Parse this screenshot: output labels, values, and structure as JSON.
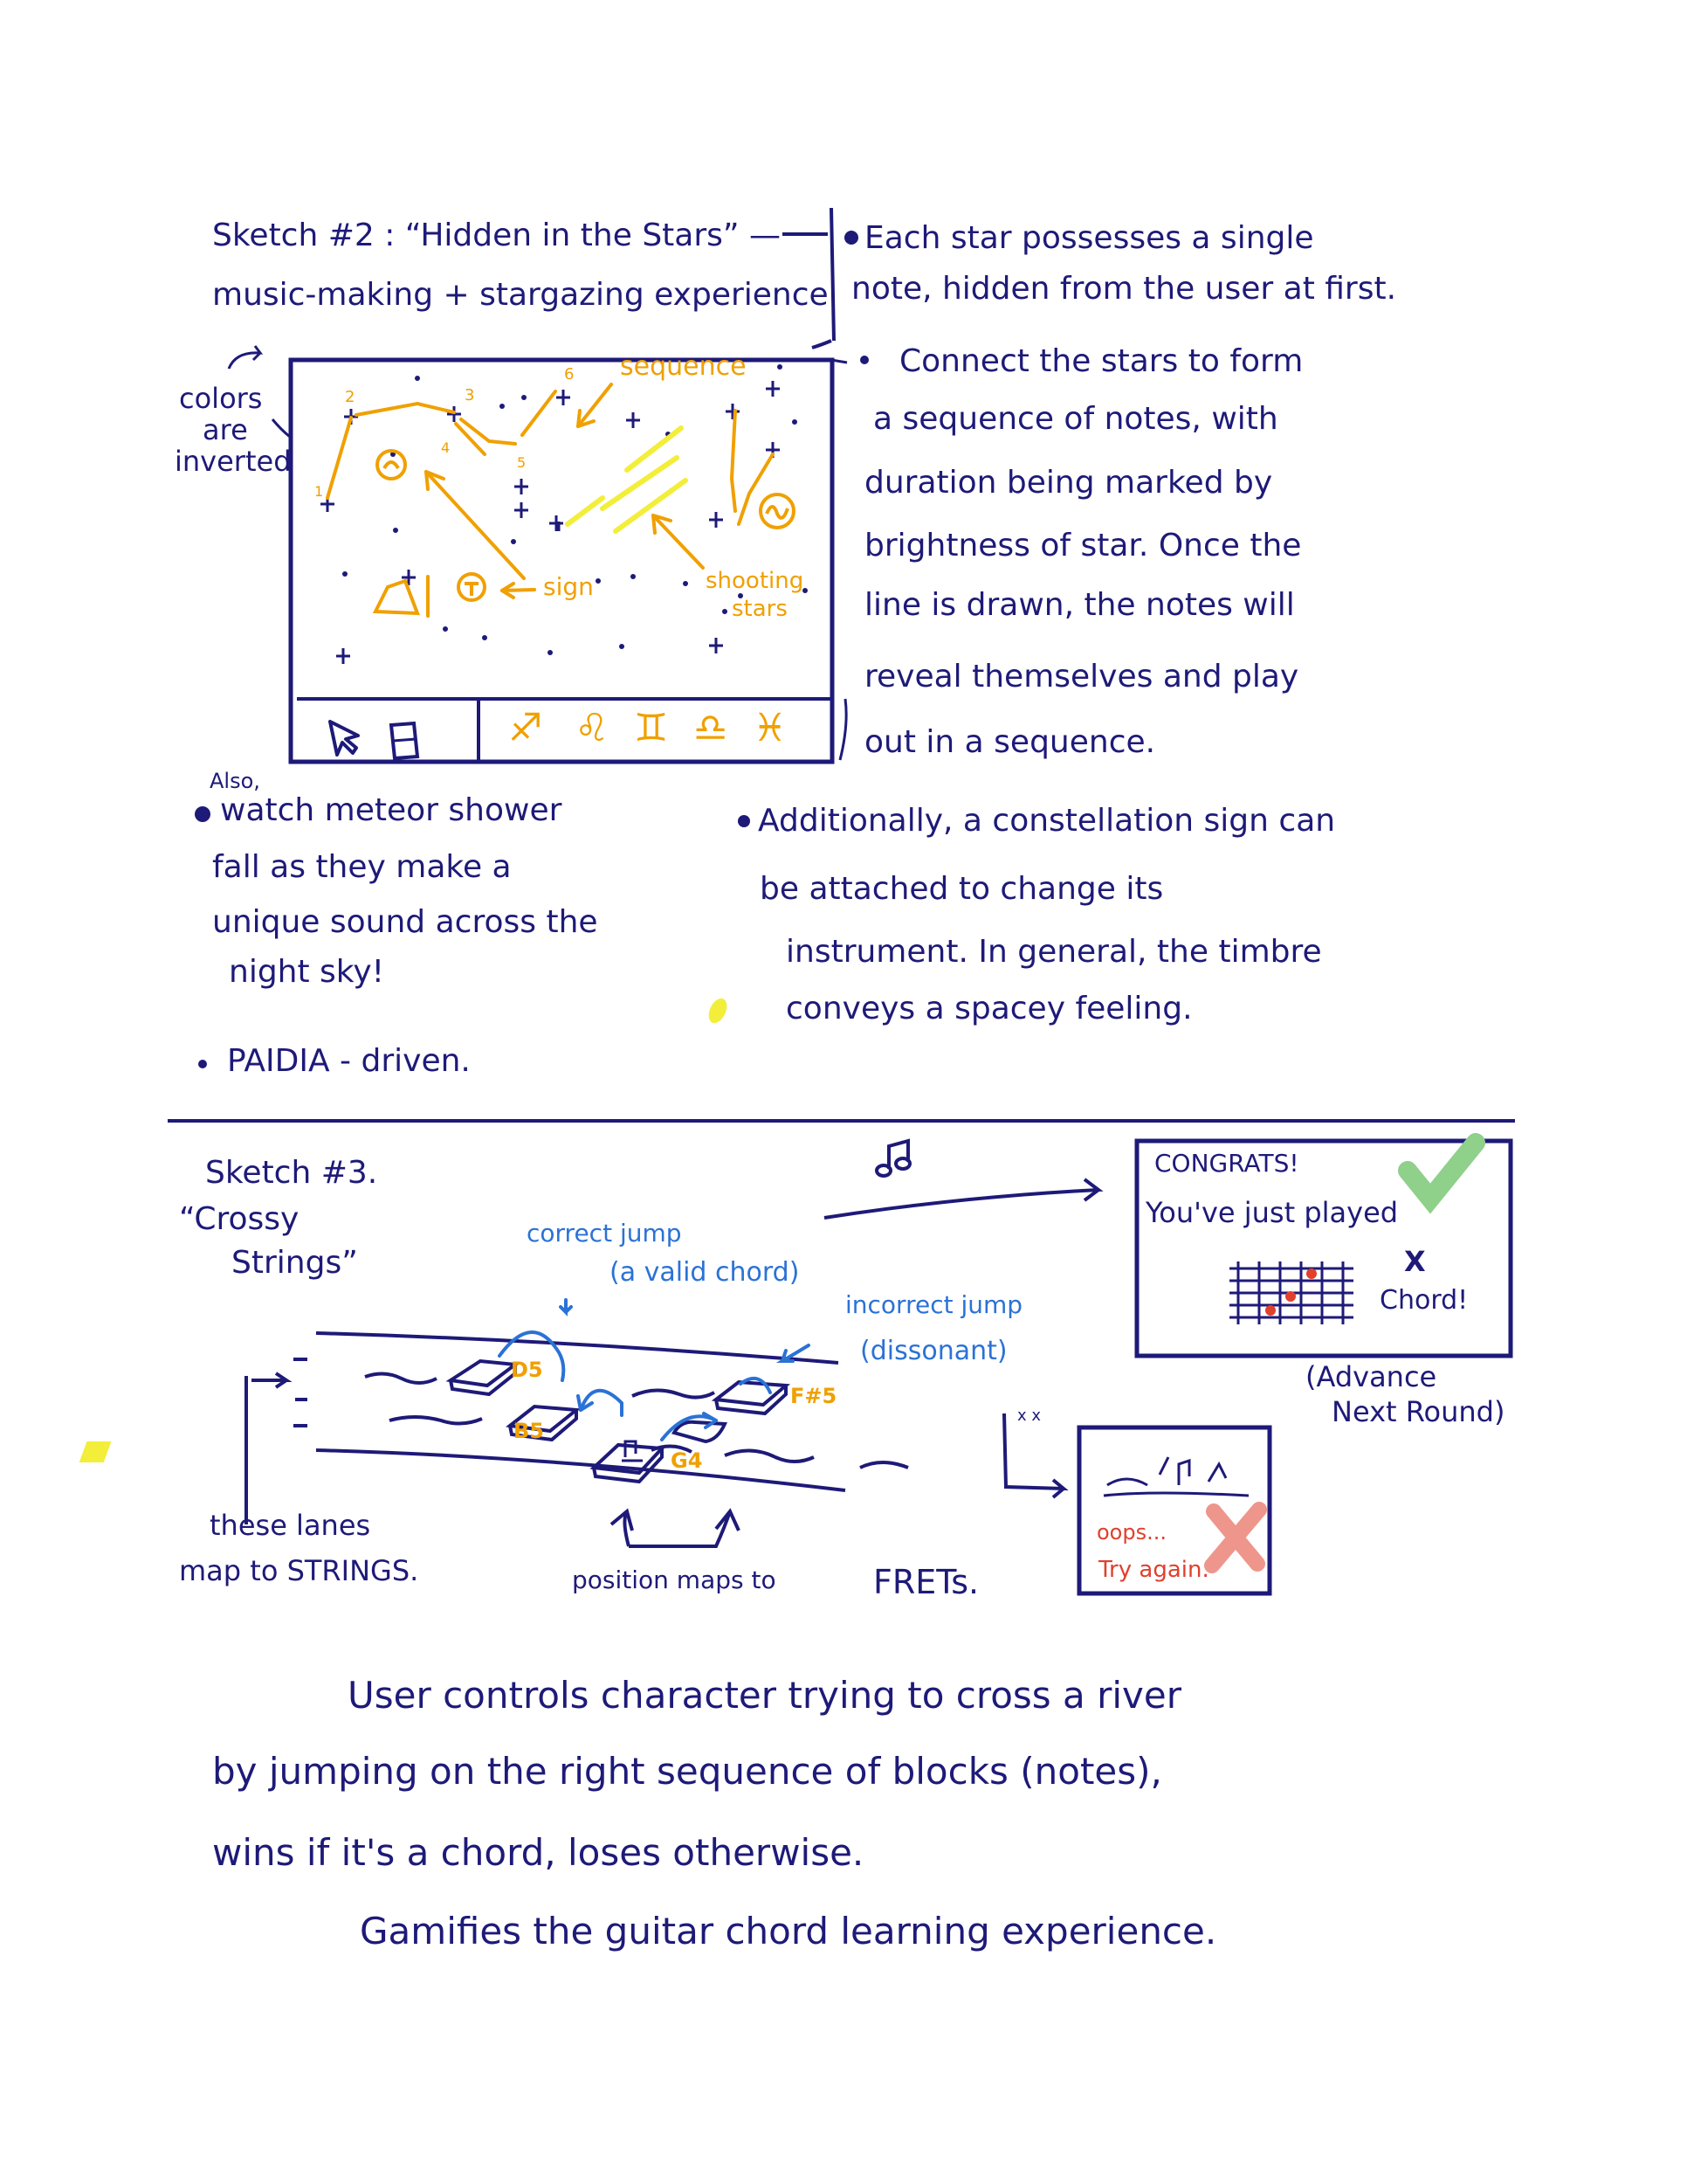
{
  "sketch2": {
    "title": "Sketch #2 : “Hidden in the Stars” —",
    "subtitle": "music-making + stargazing experience",
    "bullets": {
      "b1_l1": "Each star possesses a single",
      "b1_l2": "note, hidden from the user at first.",
      "b2_l1": "Connect the stars to form",
      "b2_l2": "a sequence of notes, with",
      "b2_l3": "duration being marked by",
      "b2_l4": "brightness of star. Once the",
      "b2_l5": "line is drawn, the notes will",
      "b2_l6": "reveal themselves and play",
      "b2_l7": "out in a sequence."
    },
    "colors_note": [
      "colors",
      "are",
      "inverted"
    ],
    "labels": {
      "sequence": "sequence",
      "sign": "sign",
      "shooting_l1": "shooting",
      "shooting_l2": "stars",
      "n2": "2",
      "n3": "3",
      "n4": "4",
      "n5": "5",
      "n6": "6",
      "n1": "1"
    },
    "toolbar_signs": [
      "♐",
      "♌",
      "♊",
      "♎",
      "♓"
    ],
    "also": "Also,",
    "meteor": [
      "watch meteor shower",
      "fall as they make a",
      "unique sound across the",
      "night sky!"
    ],
    "paidia": "PAIDIA - driven.",
    "additional": [
      "Additionally, a constellation sign can",
      "be attached to change its",
      "instrument. In general, the timbre",
      "conveys a spacey feeling."
    ]
  },
  "sketch3": {
    "title": "Sketch #3.",
    "name_l1": "“Crossy",
    "name_l2": "Strings”",
    "correct_l1": "correct jump",
    "correct_l2": "(a valid chord)",
    "incorrect_l1": "incorrect jump",
    "incorrect_l2": "(dissonant)",
    "notes": {
      "d5": "D5",
      "b5": "B5",
      "g4": "G4",
      "fs5": "F#5"
    },
    "congrats_l1": "CONGRATS!",
    "congrats_l2": "You've just played",
    "congrats_x": "X",
    "congrats_chord": "Chord!",
    "advance_l1": "(Advance",
    "advance_l2": "Next Round)",
    "oops": "oops...",
    "try_again": "Try again.",
    "face": "x x",
    "lanes_l1": "these lanes",
    "lanes_l2": "map to STRINGS.",
    "position": "position maps to",
    "frets": "FRETs.",
    "desc": [
      "User controls character trying to cross a river",
      "by jumping on the right sequence of blocks (notes),",
      "wins if it's a chord, loses otherwise.",
      "Gamifies the guitar chord learning experience."
    ]
  },
  "colors": {
    "ink": "#1e1a78",
    "orange": "#f0a000",
    "yellow": "#f2ee3a",
    "blue": "#2b72d6",
    "red": "#e0402e",
    "green": "#8fd08a"
  }
}
